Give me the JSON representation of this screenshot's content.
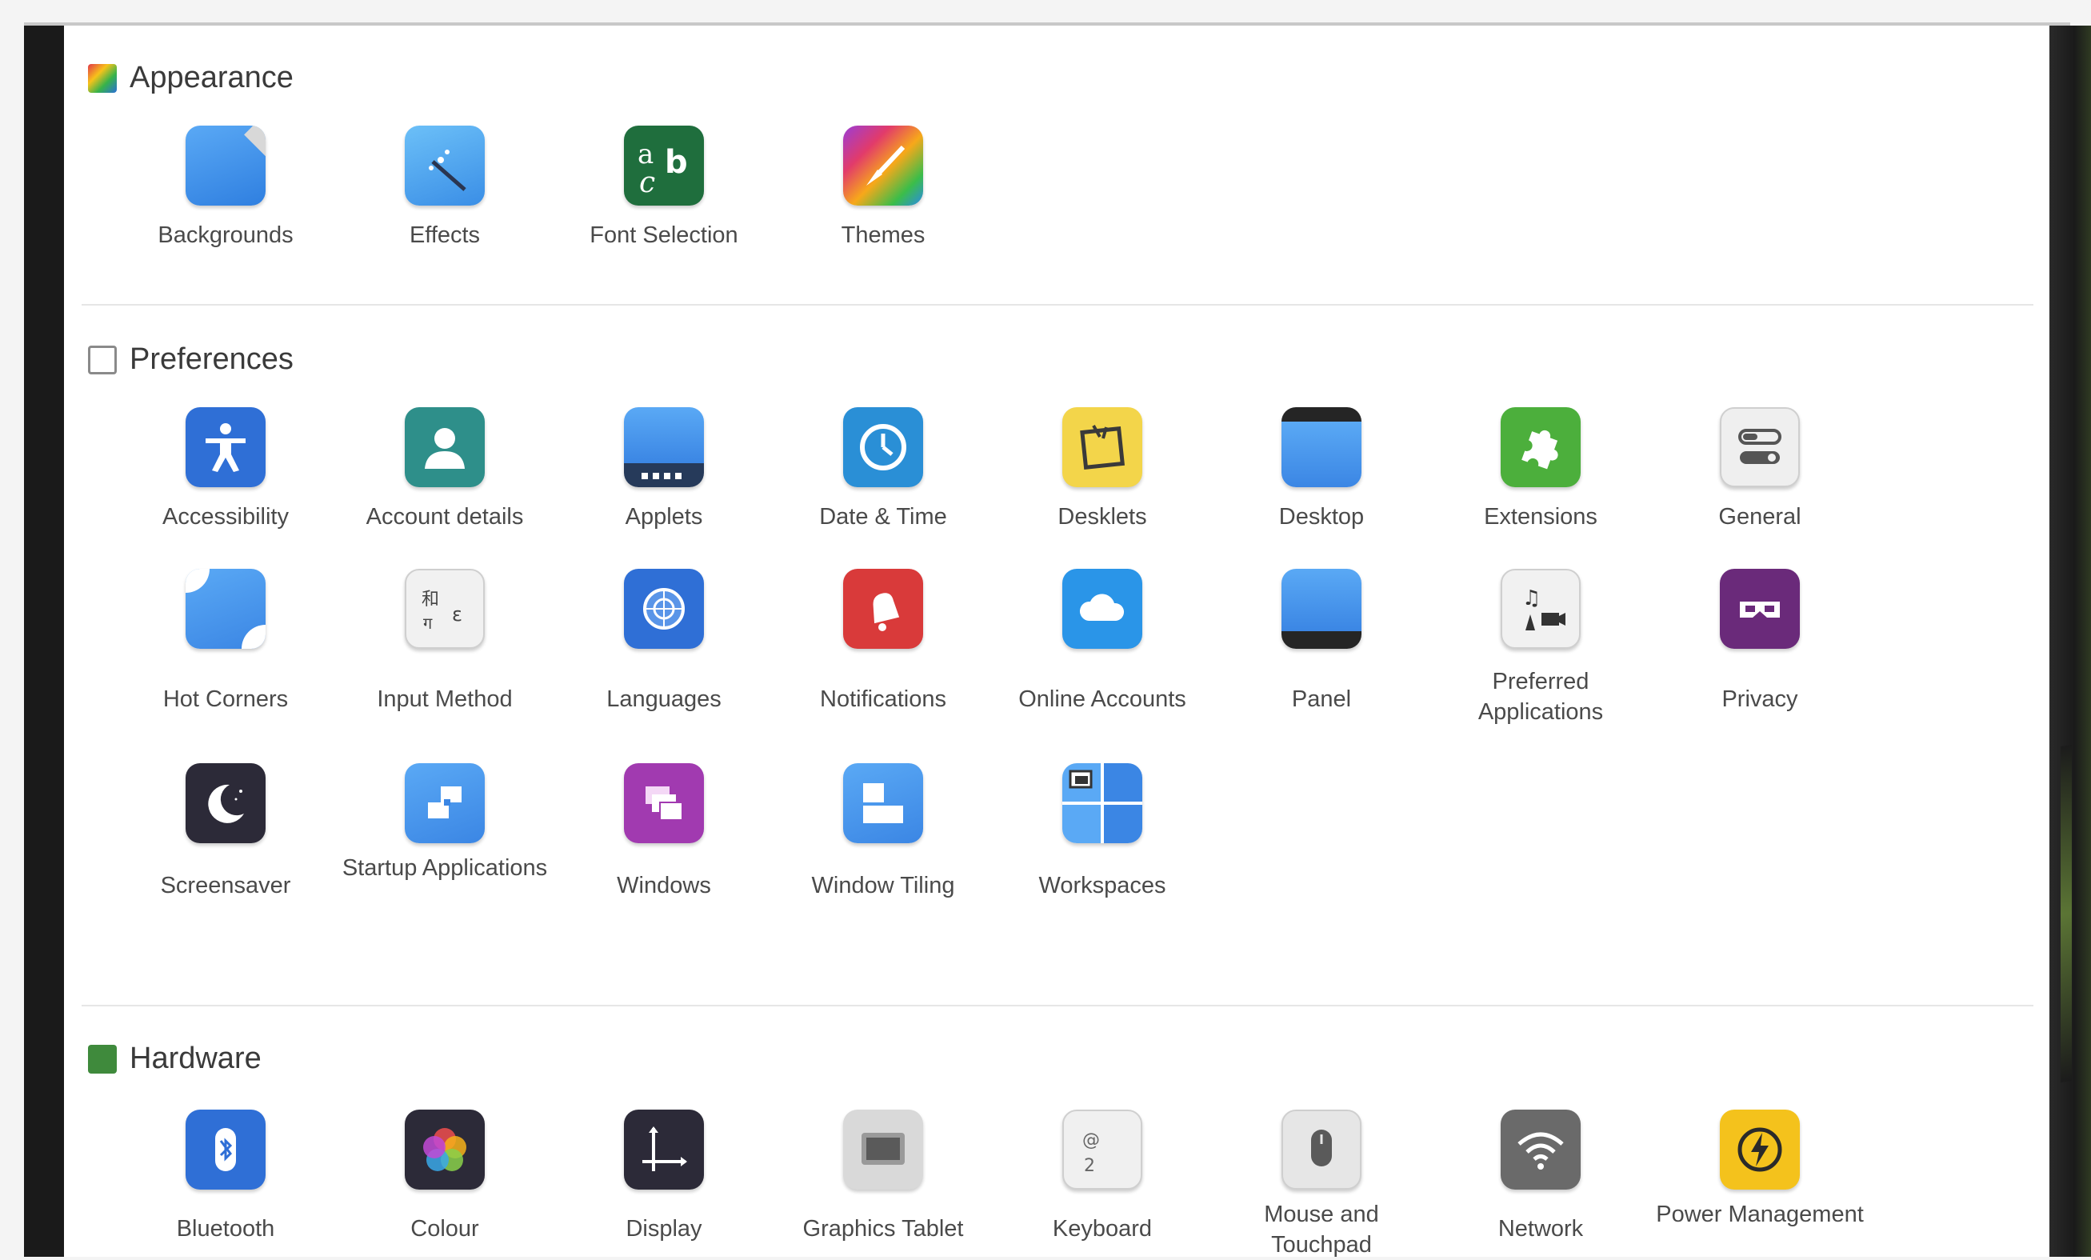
{
  "sections": {
    "appearance": {
      "title": "Appearance",
      "items": [
        "Backgrounds",
        "Effects",
        "Font Selection",
        "Themes"
      ]
    },
    "preferences": {
      "title": "Preferences",
      "items": [
        "Accessibility",
        "Account details",
        "Applets",
        "Date & Time",
        "Desklets",
        "Desktop",
        "Extensions",
        "General",
        "Hot Corners",
        "Input Method",
        "Languages",
        "Notifications",
        "Online Accounts",
        "Panel",
        "Preferred Applications",
        "Privacy",
        "Screensaver",
        "Startup Applications",
        "Windows",
        "Window Tiling",
        "Workspaces"
      ]
    },
    "hardware": {
      "title": "Hardware",
      "items": [
        "Bluetooth",
        "Colour",
        "Display",
        "Graphics Tablet",
        "Keyboard",
        "Mouse and Touchpad",
        "Network",
        "Power Management"
      ]
    }
  },
  "icons": {
    "appearance": [
      "backgrounds-icon",
      "effects-icon",
      "font-selection-icon",
      "themes-icon"
    ],
    "hardware": [
      "bluetooth-icon",
      "colour-icon",
      "display-icon",
      "graphics-tablet-icon",
      "keyboard-icon",
      "mouse-icon",
      "network-icon",
      "power-icon"
    ]
  },
  "colors": {
    "accessibility": "#2f6fd6",
    "account": "#2e8f8a",
    "notifications": "#d93a3a",
    "privacy": "#6a2a7a",
    "extensions": "#4caf3c",
    "desklets": "#f3d54a",
    "power": "#f4c21c"
  }
}
